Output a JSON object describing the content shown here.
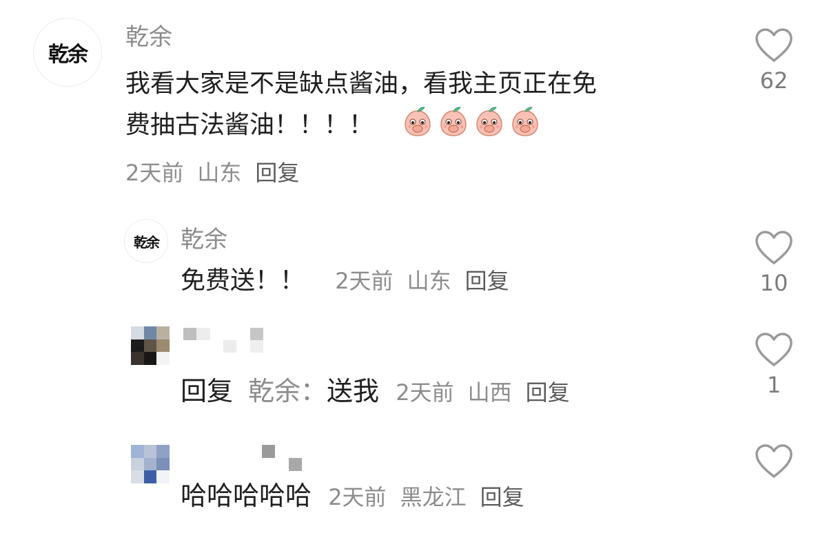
{
  "colors": {
    "meta_gray": "#8c8c8c",
    "text": "#1f1f1f",
    "heart_gray": "#9a9a9a"
  },
  "comments": [
    {
      "username": "乾余",
      "avatar_text": "乾余",
      "text_line1": "我看大家是不是缺点酱油，看我主页正在免",
      "text_line2": "费抽古法酱油！！！！",
      "emoji": "peach-cover-mouth-emoji",
      "time": "2天前",
      "location": "山东",
      "reply_label": "回复",
      "likes": "62"
    },
    {
      "username": "乾余",
      "avatar_text": "乾余",
      "text": "免费送！！",
      "time": "2天前",
      "location": "山东",
      "reply_label": "回复",
      "likes": "10"
    },
    {
      "reply_prefix": "回复",
      "reply_target": "乾余：",
      "text": "送我",
      "time": "2天前",
      "location": "山西",
      "reply_label": "回复",
      "likes": "1"
    },
    {
      "text": "哈哈哈哈哈",
      "time": "2天前",
      "location": "黑龙江",
      "reply_label": "回复",
      "likes": ""
    }
  ]
}
